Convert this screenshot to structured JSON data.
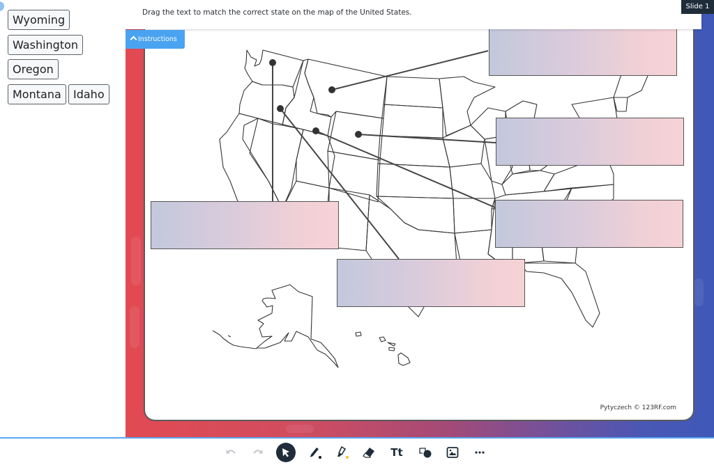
{
  "left_panel": {
    "draggable_labels": [
      {
        "text": "Wyoming"
      },
      {
        "text": "Washington"
      },
      {
        "text": "Oregon"
      },
      {
        "text": "Montana"
      },
      {
        "text": "Idaho"
      }
    ]
  },
  "slide": {
    "instruction": "Drag the text to match the correct state on the map of the United States.",
    "badge": "Slide 1",
    "instructions_toggle": "Instructions",
    "credit": "Pytyczech © 123RF.com",
    "drop_zone_count": 5
  },
  "toolbar": {
    "tools": [
      {
        "name": "undo",
        "icon": "undo-icon",
        "enabled": false
      },
      {
        "name": "redo",
        "icon": "redo-icon",
        "enabled": false
      },
      {
        "name": "select",
        "icon": "cursor-icon",
        "active": true
      },
      {
        "name": "pen",
        "icon": "pen-icon",
        "color": "#111111"
      },
      {
        "name": "highlighter",
        "icon": "highlighter-icon",
        "color": "#f2c12e"
      },
      {
        "name": "eraser",
        "icon": "eraser-icon"
      },
      {
        "name": "text",
        "icon": "text-icon",
        "label": "Tt"
      },
      {
        "name": "shapes",
        "icon": "shapes-icon"
      },
      {
        "name": "image",
        "icon": "image-icon"
      },
      {
        "name": "more",
        "icon": "more-icon",
        "label": "•••"
      }
    ]
  },
  "colors": {
    "accent": "#4aa3f0",
    "dark": "#1f2d3a",
    "gradient_left": "#e24a52",
    "gradient_right": "#3f58b8"
  }
}
